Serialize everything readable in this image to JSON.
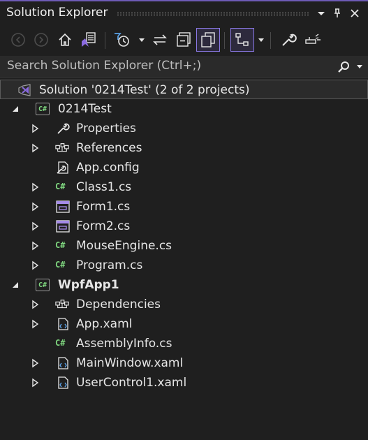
{
  "window": {
    "title": "Solution Explorer"
  },
  "search": {
    "placeholder": "Search Solution Explorer (Ctrl+;)"
  },
  "colors": {
    "accent": "#8b79e6",
    "csharp": "#7fd67f",
    "background": "#1f1f1f"
  },
  "toolbar": {
    "buttons": [
      "back-icon",
      "forward-icon",
      "home-icon",
      "switch-views-icon",
      "pending-changes-filter-icon",
      "sync-icon",
      "collapse-all-icon",
      "show-all-files-icon",
      "view-class-diagram-icon",
      "properties-wrench-icon",
      "preview-icon"
    ]
  },
  "tree": {
    "solution": "Solution '0214Test' (2 of 2 projects)",
    "project1": {
      "name": "0214Test",
      "items": [
        "Properties",
        "References",
        "App.config",
        "Class1.cs",
        "Form1.cs",
        "Form2.cs",
        "MouseEngine.cs",
        "Program.cs"
      ]
    },
    "project2": {
      "name": "WpfApp1",
      "items": [
        "Dependencies",
        "App.xaml",
        "AssemblyInfo.cs",
        "MainWindow.xaml",
        "UserControl1.xaml"
      ]
    }
  }
}
